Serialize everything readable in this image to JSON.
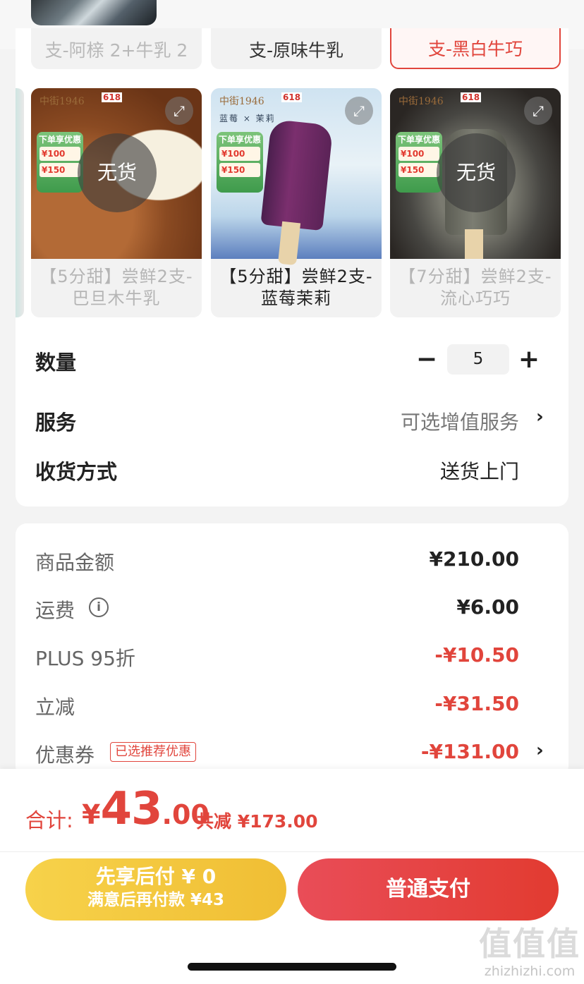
{
  "prev_variants": [
    {
      "label": "支-阿榇 2+牛乳 2"
    },
    {
      "label": "支-原味牛乳"
    },
    {
      "label": "支-黑白牛巧"
    }
  ],
  "variants": [
    {
      "name": "【5分甜】尝鲜2支-巴旦木牛乳",
      "brand": "中街1946",
      "badge": "618",
      "stock_overlay": "无货",
      "promo_title": "下单享优惠",
      "coupons": [
        "¥100",
        "¥150"
      ]
    },
    {
      "name": "【5分甜】尝鲜2支-蓝莓茉莉",
      "brand": "中街1946",
      "badge": "618",
      "subtitle": "蓝莓 × 茉莉",
      "promo_title": "下单享优惠",
      "coupons": [
        "¥100",
        "¥150"
      ]
    },
    {
      "name": "【7分甜】尝鲜2支-流心巧巧",
      "brand": "中街1946",
      "badge": "618",
      "stock_overlay": "无货",
      "promo_title": "下单享优惠",
      "coupons": [
        "¥100",
        "¥150"
      ]
    }
  ],
  "quantity": {
    "label": "数量",
    "value": "5",
    "minus": "−",
    "plus": "+"
  },
  "service": {
    "label": "服务",
    "value": "可选增值服务",
    "chevron": "›"
  },
  "delivery": {
    "label": "收货方式",
    "value": "送货上门"
  },
  "pricing": {
    "goods_label": "商品金额",
    "goods_value": "¥210.00",
    "shipping_label": "运费",
    "shipping_value": "¥6.00",
    "plus_label": "PLUS 95折",
    "plus_value": "-¥10.50",
    "instant_label": "立减",
    "instant_value": "-¥31.50",
    "coupon_label": "优惠券",
    "coupon_tag": "已选推荐优惠",
    "coupon_value": "-¥131.00"
  },
  "summary": {
    "total_label": "合计:",
    "currency": "¥",
    "total_int": "43",
    "total_dec": ".00",
    "saved": "共减 ¥173.00"
  },
  "buttons": {
    "later_line1": "先享后付 ¥ 0",
    "later_line2": "满意后再付款 ¥43",
    "pay": "普通支付"
  },
  "watermark": {
    "logo": "值值值",
    "url": "zhizhizhi.com"
  },
  "colors": {
    "accent": "#e1453c",
    "gold": "#f0be34"
  }
}
